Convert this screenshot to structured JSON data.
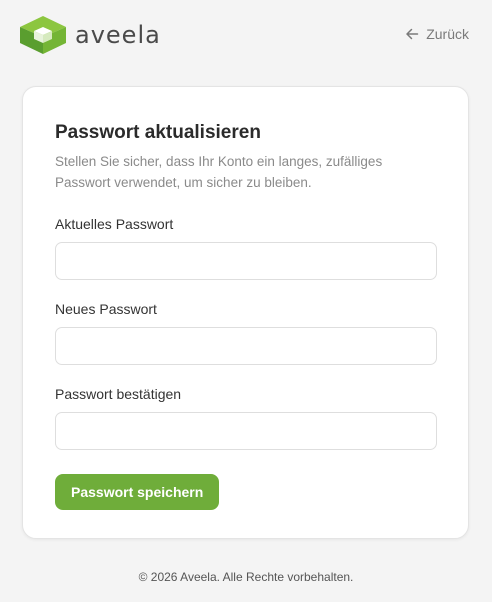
{
  "header": {
    "logo_text": "aveela",
    "back_label": "Zurück"
  },
  "icons": {
    "logo": "aveela-logo-icon",
    "back": "arrow-left-icon"
  },
  "colors": {
    "accent": "#6fad3a",
    "logo_light": "#8cc63f",
    "logo_dark": "#5a9e2f",
    "background": "#f4f4f4"
  },
  "form": {
    "title": "Passwort aktualisieren",
    "description": "Stellen Sie sicher, dass Ihr Konto ein langes, zufälliges Passwort verwendet, um sicher zu bleiben.",
    "fields": [
      {
        "label": "Aktuelles Passwort",
        "value": "",
        "placeholder": ""
      },
      {
        "label": "Neues Passwort",
        "value": "",
        "placeholder": ""
      },
      {
        "label": "Passwort bestätigen",
        "value": "",
        "placeholder": ""
      }
    ],
    "submit_label": "Passwort speichern"
  },
  "footer": {
    "copyright": "© 2026 Aveela. Alle Rechte vorbehalten."
  }
}
